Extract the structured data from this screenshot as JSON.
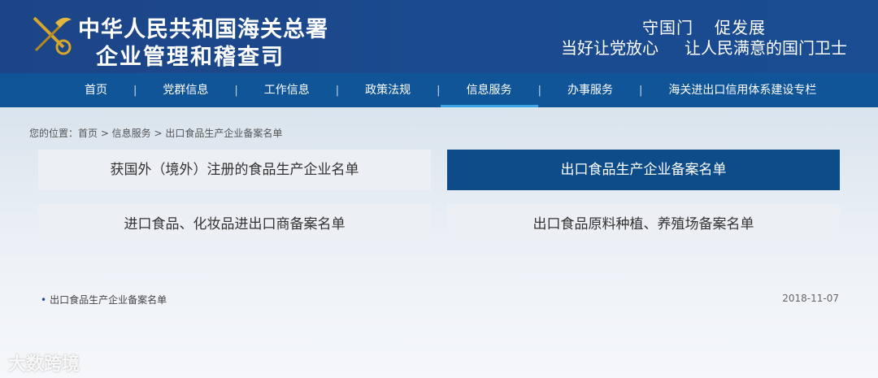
{
  "header": {
    "title_line1": "中华人民共和国海关总署",
    "title_line2": "企业管理和稽查司",
    "slogan_line1": [
      "守国门",
      "促发展"
    ],
    "slogan_line2": [
      "当好让党放心",
      "让人民满意的国门卫士"
    ]
  },
  "nav": {
    "items": [
      "首页",
      "党群信息",
      "工作信息",
      "政策法规",
      "信息服务",
      "办事服务",
      "海关进出口信用体系建设专栏"
    ],
    "separator": "|",
    "active": "信息服务"
  },
  "breadcrumb": "您的位置：首页 > 信息服务 > 出口食品生产企业备案名单",
  "buttons": [
    "获国外（境外）注册的食品生产企业名单",
    "出口食品生产企业备案名单",
    "进口食品、化妆品进出口商备案名单",
    "出口食品原料种植、养殖场备案名单"
  ],
  "list": [
    {
      "title": "出口食品生产企业备案名单",
      "date": "2018-11-07"
    }
  ],
  "watermark": "大数跨境",
  "colors": {
    "header": "#1c4587",
    "nav": "#0f5598",
    "active_button": "#0d4b89",
    "active_underline": "#3ba3e6"
  }
}
